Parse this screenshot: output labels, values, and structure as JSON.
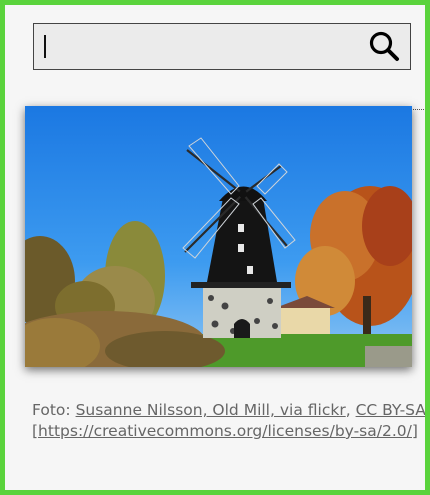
{
  "search": {
    "value": "",
    "placeholder": "",
    "icon": "search-icon"
  },
  "photo": {
    "subject": "windmill",
    "sky_color": "#2a8bea",
    "grass_color": "#4e9a2a",
    "mill_body_color": "#141414"
  },
  "caption": {
    "prefix": "Foto: ",
    "source_link": "Susanne Nilsson, Old Mill, via flickr",
    "separator": ",",
    "license_link": "CC BY-SA",
    "space": " ",
    "url_link": "[https://creativecommons.org/licenses/by-sa/2.0/]"
  }
}
